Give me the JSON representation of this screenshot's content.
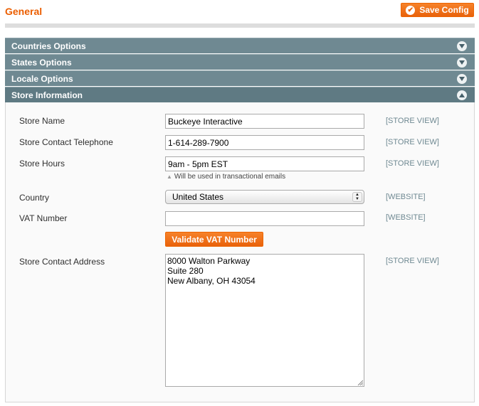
{
  "header": {
    "title": "General",
    "save_label": "Save Config",
    "save_icon": "checkmark-icon"
  },
  "sections": [
    {
      "label": "Countries Options",
      "state": "collapsed"
    },
    {
      "label": "States Options",
      "state": "collapsed"
    },
    {
      "label": "Locale Options",
      "state": "collapsed"
    },
    {
      "label": "Store Information",
      "state": "expanded"
    }
  ],
  "store_info": {
    "store_name": {
      "label": "Store Name",
      "value": "Buckeye Interactive",
      "scope": "[STORE VIEW]"
    },
    "telephone": {
      "label": "Store Contact Telephone",
      "value": "1-614-289-7900",
      "scope": "[STORE VIEW]"
    },
    "hours": {
      "label": "Store Hours",
      "value": "9am - 5pm EST",
      "scope": "[STORE VIEW]",
      "note": "Will be used in transactional emails"
    },
    "country": {
      "label": "Country",
      "value": "United States",
      "scope": "[WEBSITE]"
    },
    "vat": {
      "label": "VAT Number",
      "value": "",
      "scope": "[WEBSITE]",
      "validate_label": "Validate VAT Number"
    },
    "address": {
      "label": "Store Contact Address",
      "scope": "[STORE VIEW]",
      "lines": [
        "8000 Walton Parkway",
        "Suite 280",
        "New Albany, OH 43054"
      ]
    }
  },
  "colors": {
    "accent": "#eb5e00",
    "section_header": "#6f8992",
    "scope_text": "#6f8992"
  }
}
